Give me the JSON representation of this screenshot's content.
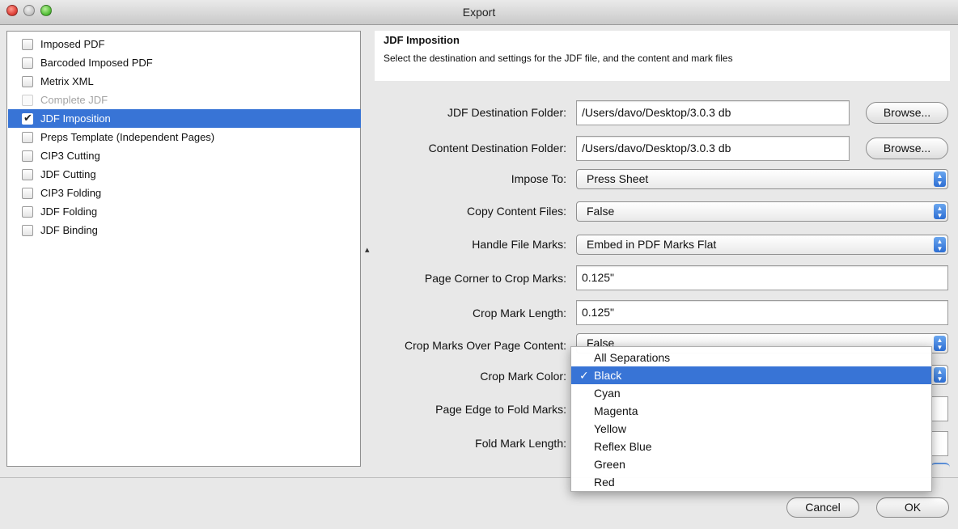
{
  "window": {
    "title": "Export"
  },
  "list": {
    "items": [
      {
        "label": "Imposed PDF",
        "checked": false,
        "selected": false,
        "disabled": false
      },
      {
        "label": "Barcoded Imposed PDF",
        "checked": false,
        "selected": false,
        "disabled": false
      },
      {
        "label": "Metrix XML",
        "checked": false,
        "selected": false,
        "disabled": false
      },
      {
        "label": "Complete JDF",
        "checked": false,
        "selected": false,
        "disabled": true
      },
      {
        "label": "JDF Imposition",
        "checked": true,
        "selected": true,
        "disabled": false
      },
      {
        "label": "Preps Template (Independent Pages)",
        "checked": false,
        "selected": false,
        "disabled": false
      },
      {
        "label": "CIP3 Cutting",
        "checked": false,
        "selected": false,
        "disabled": false
      },
      {
        "label": "JDF Cutting",
        "checked": false,
        "selected": false,
        "disabled": false
      },
      {
        "label": "CIP3 Folding",
        "checked": false,
        "selected": false,
        "disabled": false
      },
      {
        "label": "JDF Folding",
        "checked": false,
        "selected": false,
        "disabled": false
      },
      {
        "label": "JDF Binding",
        "checked": false,
        "selected": false,
        "disabled": false
      }
    ]
  },
  "header": {
    "title": "JDF Imposition",
    "description": "Select the destination and settings for the JDF file, and the content and mark files"
  },
  "form": {
    "jdf_destination": {
      "label": "JDF Destination Folder:",
      "value": "/Users/davo/Desktop/3.0.3 db",
      "browse": "Browse..."
    },
    "content_destination": {
      "label": "Content Destination Folder:",
      "value": "/Users/davo/Desktop/3.0.3 db",
      "browse": "Browse..."
    },
    "impose_to": {
      "label": "Impose To:",
      "value": "Press Sheet"
    },
    "copy_content_files": {
      "label": "Copy Content Files:",
      "value": "False"
    },
    "handle_file_marks": {
      "label": "Handle File Marks:",
      "value": "Embed in PDF Marks Flat"
    },
    "page_corner_to_crop_marks": {
      "label": "Page Corner to Crop Marks:",
      "value": "0.125\""
    },
    "crop_mark_length": {
      "label": "Crop Mark Length:",
      "value": "0.125\""
    },
    "crop_marks_over_page_content": {
      "label": "Crop Marks Over Page Content:",
      "value": "False"
    },
    "crop_mark_color": {
      "label": "Crop Mark Color:"
    },
    "page_edge_to_fold_marks": {
      "label": "Page Edge to Fold Marks:"
    },
    "fold_mark_length": {
      "label": "Fold Mark Length:"
    }
  },
  "color_menu": {
    "options": [
      "All Separations",
      "Black",
      "Cyan",
      "Magenta",
      "Yellow",
      "Reflex Blue",
      "Green",
      "Red"
    ],
    "selected": "Black",
    "check_glyph": "✓"
  },
  "buttons": {
    "cancel": "Cancel",
    "ok": "OK"
  },
  "icons": {
    "checkbox_check": "✔",
    "popup_arrows": "▲▼"
  },
  "colors": {
    "selection": "#3874d6",
    "popup_accent": "#2d6ed3"
  }
}
